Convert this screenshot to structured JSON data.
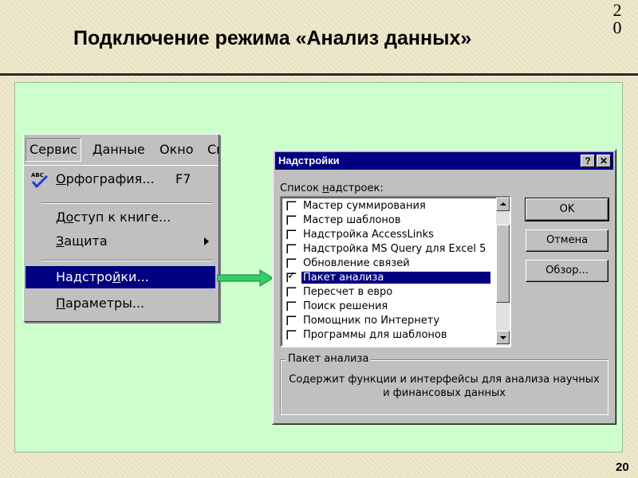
{
  "slide": {
    "corner_number": "20",
    "title": "Подключение режима «Анализ данных»",
    "page_number": "20"
  },
  "menu": {
    "menubar": [
      "Сервис",
      "Данные",
      "Окно",
      "Сп"
    ],
    "items": [
      {
        "label_pre": "",
        "label_u": "О",
        "label_post": "рфография...",
        "accelerator": "F7",
        "icon": "spellcheck-icon"
      },
      {
        "label_pre": "Д",
        "label_u": "о",
        "label_post": "ступ к книге...",
        "accelerator": ""
      },
      {
        "label_pre": "",
        "label_u": "З",
        "label_post": "ащита",
        "accelerator": "",
        "submenu": true
      },
      {
        "label_pre": "Надстро",
        "label_u": "й",
        "label_post": "ки...",
        "accelerator": "",
        "highlighted": true
      },
      {
        "label_pre": "",
        "label_u": "П",
        "label_post": "араметры...",
        "accelerator": ""
      }
    ]
  },
  "arrow": {
    "color": "#33cc66",
    "icon": "right-arrow-icon"
  },
  "dialog": {
    "title": "Надстройки",
    "help_button": "?",
    "close_button": "✕",
    "list_label_pre": "Список ",
    "list_label_u": "н",
    "list_label_post": "адстроек:",
    "addins": [
      {
        "label": "Мастер суммирования",
        "checked": false,
        "selected": false
      },
      {
        "label": "Мастер шаблонов",
        "checked": false,
        "selected": false
      },
      {
        "label": "Надстройка AccessLinks",
        "checked": false,
        "selected": false
      },
      {
        "label": "Надстройка MS Query для Excel 5",
        "checked": false,
        "selected": false
      },
      {
        "label": "Обновление связей",
        "checked": false,
        "selected": false
      },
      {
        "label": "Пакет анализа",
        "checked": true,
        "selected": true
      },
      {
        "label": "Пересчет в евро",
        "checked": false,
        "selected": false
      },
      {
        "label": "Поиск решения",
        "checked": false,
        "selected": false
      },
      {
        "label": "Помощник по Интернету",
        "checked": false,
        "selected": false
      },
      {
        "label": "Программы для шаблонов",
        "checked": false,
        "selected": false
      }
    ],
    "ok_label": "OK",
    "cancel_label": "Отмена",
    "browse_label": "Обзор...",
    "group_title": "Пакет анализа",
    "group_description_line1": "Содержит функции и интерфейсы для анализа научных",
    "group_description_line2": "и финансовых данных"
  },
  "colors": {
    "panel_bg": "#ccffcc",
    "highlight": "#000080",
    "window_face": "#c0c0c0"
  }
}
